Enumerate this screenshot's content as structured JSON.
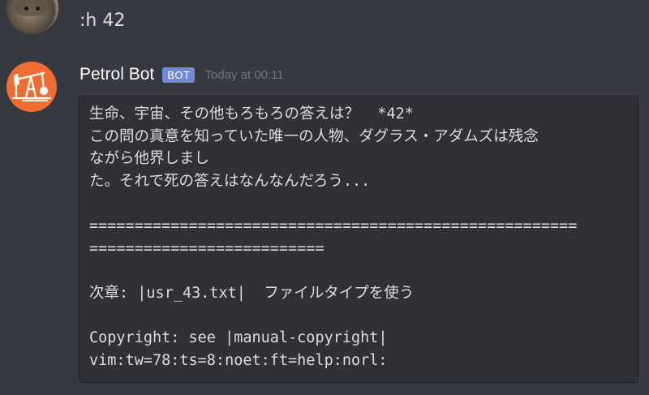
{
  "previous_message": {
    "text": ":h 42"
  },
  "bot_message": {
    "author": "Petrol Bot",
    "tag": "BOT",
    "timestamp": "Today at 00:11",
    "code_lines": [
      "生命、宇宙、その他もろもろの答えは？  *42*",
      "この問の真意を知っていた唯一の人物、ダグラス・アダムズは残念",
      "ながら他界しまし",
      "た。それで死の答えはなんなんだろう...",
      "",
      "======================================================",
      "==========================",
      "",
      "次章: |usr_43.txt|  ファイルタイプを使う",
      "",
      "Copyright: see |manual-copyright|",
      "vim:tw=78:ts=8:noet:ft=help:norl:"
    ]
  },
  "colors": {
    "background": "#36393f",
    "codeblock_bg": "#2f3136",
    "bot_tag": "#7289da",
    "bot_avatar": "#ef6d32",
    "timestamp": "#72767d"
  },
  "icons": {
    "user_avatar": "badger-photo-avatar",
    "bot_avatar": "oil-pumpjack-icon"
  }
}
